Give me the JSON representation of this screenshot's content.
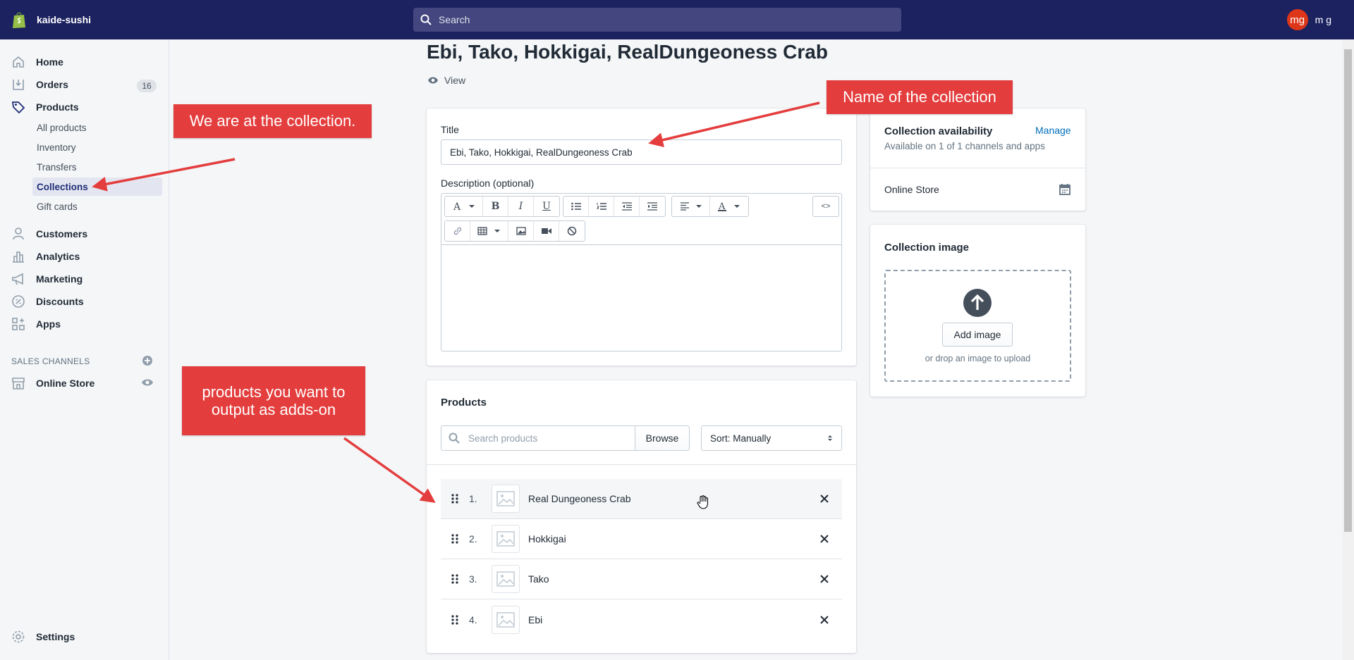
{
  "topbar": {
    "store_name": "kaide-sushi",
    "search_placeholder": "Search",
    "avatar_initials": "mg",
    "user_name": "m g"
  },
  "sidebar": {
    "home": "Home",
    "orders": "Orders",
    "orders_badge": "16",
    "products": "Products",
    "sub": [
      "All products",
      "Inventory",
      "Transfers",
      "Collections",
      "Gift cards"
    ],
    "customers": "Customers",
    "analytics": "Analytics",
    "marketing": "Marketing",
    "discounts": "Discounts",
    "apps": "Apps",
    "sales_channels_label": "SALES CHANNELS",
    "online_store": "Online Store",
    "settings": "Settings"
  },
  "page": {
    "title": "Ebi, Tako, Hokkigai, RealDungeoness Crab",
    "view_label": "View"
  },
  "form": {
    "title_label": "Title",
    "title_value": "Ebi, Tako, Hokkigai, RealDungeoness Crab",
    "description_label": "Description (optional)",
    "html_toggle": "<>"
  },
  "products_card": {
    "heading": "Products",
    "search_placeholder": "Search products",
    "browse_label": "Browse",
    "sort_label": "Sort: Manually",
    "items": [
      {
        "num": "1.",
        "name": "Real Dungeoness Crab"
      },
      {
        "num": "2.",
        "name": "Hokkigai"
      },
      {
        "num": "3.",
        "name": "Tako"
      },
      {
        "num": "4.",
        "name": "Ebi"
      }
    ]
  },
  "availability": {
    "heading": "Collection availability",
    "manage_label": "Manage",
    "summary": "Available on 1 of 1 channels and apps",
    "channel": "Online Store"
  },
  "collection_image": {
    "heading": "Collection image",
    "add_label": "Add image",
    "drop_hint": "or drop an image to upload"
  },
  "annotations": {
    "at_collection": "We are at the collection.",
    "collection_name": "Name of the collection",
    "products_addon": "products you want to output as adds-on"
  },
  "colors": {
    "topbar": "#1c2260",
    "accent": "#202e78",
    "annotation": "#e43d3d",
    "link": "#006fbb"
  }
}
